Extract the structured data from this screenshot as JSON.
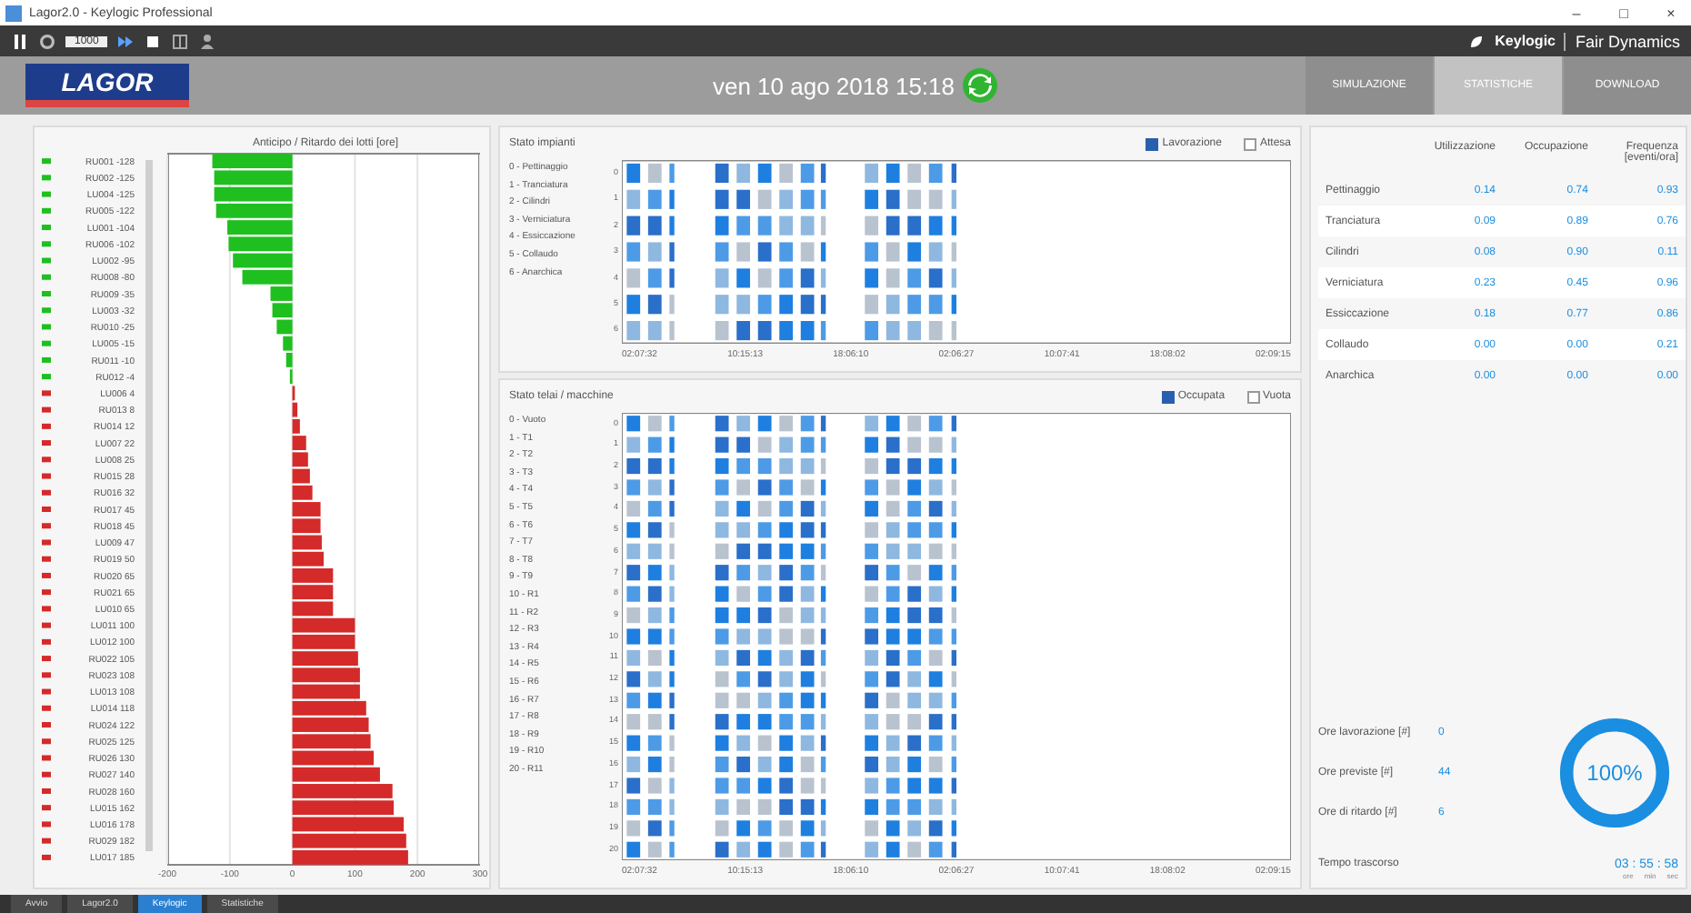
{
  "window": {
    "title": "Lagor2.0 - Keylogic Professional",
    "controls": [
      "–",
      "□",
      "×"
    ]
  },
  "toolbar": {
    "speed": "1000",
    "brand": "Keylogic",
    "product": "Fair Dynamics"
  },
  "header": {
    "logo": "LAGOR",
    "date": "ven 10 ago 2018  15:18",
    "tabs": [
      {
        "label": "SIMULAZIONE",
        "selected": false
      },
      {
        "label": "STATISTICHE",
        "selected": true
      },
      {
        "label": "DOWNLOAD",
        "selected": false
      }
    ]
  },
  "lots_chart": {
    "chart_data": {
      "type": "bar",
      "orientation": "horizontal",
      "grid": true,
      "title": "Anticipo / Ritardo dei lotti [ore]",
      "categories": [
        "RU001 -128",
        "RU002 -125",
        "LU004 -125",
        "RU005 -122",
        "LU001 -104",
        "RU006 -102",
        "LU002 -95",
        "RU008 -80",
        "RU009 -35",
        "LU003 -32",
        "RU010 -25",
        "LU005 -15",
        "RU011 -10",
        "RU012 -4",
        "LU006 4",
        "RU013 8",
        "RU014 12",
        "LU007 22",
        "LU008 25",
        "RU015 28",
        "RU016 32",
        "RU017 45",
        "RU018 45",
        "LU009 47",
        "RU019 50",
        "RU020 65",
        "RU021 65",
        "LU010 65",
        "LU011 100",
        "LU012 100",
        "RU022 105",
        "RU023 108",
        "LU013 108",
        "LU014 118",
        "RU024 122",
        "RU025 125",
        "RU026 130",
        "RU027 140",
        "RU028 160",
        "LU015 162",
        "LU016 178",
        "RU029 182",
        "LU017 185"
      ],
      "series": [
        {
          "color": "#1fbf1f",
          "values": [
            -128,
            -125,
            -125,
            -122,
            -104,
            -102,
            -95,
            -80,
            -35,
            -32,
            -25,
            -15,
            -10,
            -4,
            null,
            null,
            null,
            null,
            null,
            null,
            null,
            null,
            null,
            null,
            null,
            null,
            null,
            null,
            null,
            null,
            null,
            null,
            null,
            null,
            null,
            null,
            null,
            null,
            null,
            null,
            null,
            null,
            null
          ]
        },
        {
          "color": "#d42a2a",
          "values": [
            null,
            null,
            null,
            null,
            null,
            null,
            null,
            null,
            null,
            null,
            null,
            null,
            null,
            null,
            4,
            8,
            12,
            22,
            25,
            28,
            32,
            45,
            45,
            47,
            50,
            65,
            65,
            65,
            100,
            100,
            105,
            108,
            108,
            118,
            122,
            125,
            130,
            140,
            160,
            162,
            178,
            182,
            185
          ]
        }
      ],
      "xlim": [
        -200,
        300
      ],
      "xticks": [
        -200,
        -100,
        0,
        100,
        200,
        300
      ]
    }
  },
  "plants": {
    "title": "Stato impianti",
    "legend": [
      {
        "label": "Lavorazione",
        "selected": true
      },
      {
        "label": "Attesa",
        "selected": false
      }
    ],
    "rows": [
      "0 - Pettinaggio",
      "1 - Tranciatura",
      "2 - Cilindri",
      "3 - Verniciatura",
      "4 - Essiccazione",
      "5 - Collaudo",
      "6 - Anarchica"
    ],
    "y_ticks": [
      "0",
      "1",
      "2",
      "3",
      "4",
      "5",
      "6"
    ],
    "x_ticks": [
      "02:07:32",
      "10:15:13",
      "18:06:10",
      "02:06:27",
      "10:07:41",
      "18:08:02",
      "02:09:15"
    ]
  },
  "machines": {
    "title": "Stato telai / macchine",
    "legend": [
      {
        "label": "Occupata",
        "selected": true
      },
      {
        "label": "Vuota",
        "selected": false
      }
    ],
    "rows": [
      "0 - Vuoto",
      "1 - T1",
      "2 - T2",
      "3 - T3",
      "4 - T4",
      "5 - T5",
      "6 - T6",
      "7 - T7",
      "8 - T8",
      "9 - T9",
      "10 - R1",
      "11 - R2",
      "12 - R3",
      "13 - R4",
      "14 - R5",
      "15 - R6",
      "16 - R7",
      "17 - R8",
      "18 - R9",
      "19 - R10",
      "20 - R11"
    ],
    "y_ticks": [
      "0",
      "1",
      "2",
      "3",
      "4",
      "5",
      "6",
      "7",
      "8",
      "9",
      "10",
      "11",
      "12",
      "13",
      "14",
      "15",
      "16",
      "17",
      "18",
      "19",
      "20"
    ],
    "x_ticks": [
      "02:07:32",
      "10:15:13",
      "18:06:10",
      "02:06:27",
      "10:07:41",
      "18:08:02",
      "02:09:15"
    ]
  },
  "table": {
    "columns": [
      "Utilizzazione",
      "Occupazione",
      "Frequenza [eventi/ora]"
    ],
    "rows": [
      {
        "name": "Pettinaggio",
        "cells": [
          "0.14",
          "0.74",
          "0.93"
        ]
      },
      {
        "name": "Tranciatura",
        "cells": [
          "0.09",
          "0.89",
          "0.76"
        ]
      },
      {
        "name": "Cilindri",
        "cells": [
          "0.08",
          "0.90",
          "0.11"
        ]
      },
      {
        "name": "Verniciatura",
        "cells": [
          "0.23",
          "0.45",
          "0.96"
        ]
      },
      {
        "name": "Essiccazione",
        "cells": [
          "0.18",
          "0.77",
          "0.86"
        ]
      },
      {
        "name": "Collaudo",
        "cells": [
          "0.00",
          "0.00",
          "0.21"
        ]
      },
      {
        "name": "Anarchica",
        "cells": [
          "0.00",
          "0.00",
          "0.00"
        ]
      }
    ]
  },
  "summary": {
    "stats": [
      {
        "label": "Ore lavorazione [#]",
        "value": "0"
      },
      {
        "label": "Ore previste [#]",
        "value": "44"
      },
      {
        "label": "Ore di ritardo [#]",
        "value": "6"
      }
    ],
    "elapsed_label": "Tempo trascorso",
    "elapsed": "03 : 55 : 58",
    "elapsed_units": [
      "ore",
      "min",
      "sec"
    ],
    "donut": {
      "level": 1,
      "label": "100%"
    }
  },
  "taskbar": [
    {
      "label": "Avvio",
      "selected": false
    },
    {
      "label": "Lagor2.0",
      "selected": false
    },
    {
      "label": "Keylogic",
      "selected": true
    },
    {
      "label": "Statistiche",
      "selected": false
    }
  ]
}
